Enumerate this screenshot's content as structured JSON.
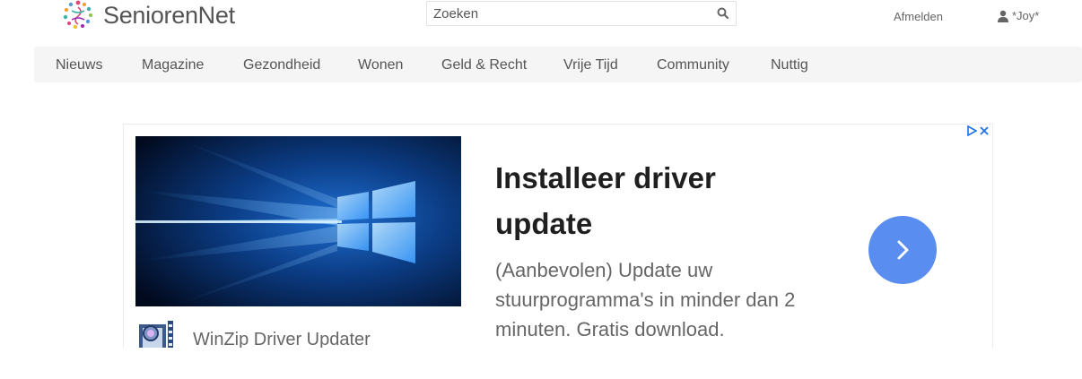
{
  "header": {
    "brand": "SeniorenNet",
    "search_placeholder": "Zoeken",
    "logout_label": "Afmelden",
    "username": "*Joy*"
  },
  "nav": {
    "items": [
      "Nieuws",
      "Magazine",
      "Gezondheid",
      "Wonen",
      "Geld & Recht",
      "Vrije Tijd",
      "Community",
      "Nuttig"
    ]
  },
  "ad": {
    "title": "Installeer driver update",
    "description": "(Aanbevolen) Update uw stuurprogramma's in minder dan 2 minuten. Gratis download.",
    "advertiser": "WinZip Driver Updater",
    "colors": {
      "cta": "#5a8df0",
      "adchoices": "#1a73e8"
    }
  },
  "icons": {
    "logo": "seniorennet-logo-icon",
    "search": "search-icon",
    "user": "user-icon",
    "adchoices": "adchoices-icon",
    "close": "close-icon",
    "cta": "chevron-right-icon"
  }
}
